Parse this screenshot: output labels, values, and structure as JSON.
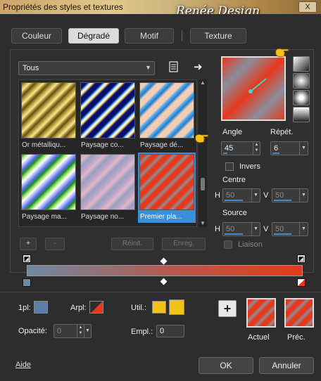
{
  "window": {
    "title": "Propriétés des styles et textures",
    "brand_text": "Renée Design",
    "close_label": "X"
  },
  "tabs": [
    {
      "label": "Couleur",
      "active": false
    },
    {
      "label": "Dégradé",
      "active": true
    },
    {
      "label": "Motif",
      "active": false
    },
    {
      "label": "Texture",
      "active": false
    }
  ],
  "category": {
    "value": "Tous"
  },
  "gradients": [
    {
      "label": "Or métalliqu...",
      "icon": "gold-stripes"
    },
    {
      "label": "Paysage co...",
      "icon": "blue-navy-stripes"
    },
    {
      "label": "Paysage dé...",
      "icon": "blue-peach-stripes"
    },
    {
      "label": "Paysage ma...",
      "icon": "green-blue-stripes"
    },
    {
      "label": "Paysage no...",
      "icon": "mauve-stripes"
    },
    {
      "label": "Premier pla...",
      "icon": "red-grey-stripes",
      "selected": true
    }
  ],
  "list_buttons": {
    "add": "+",
    "remove": "-",
    "reset": "Réinit.",
    "save": "Enreg."
  },
  "angle": {
    "label": "Angle",
    "value": "45"
  },
  "repeat": {
    "label": "Répét.",
    "value": "6"
  },
  "invert": {
    "label": "Invers",
    "checked": false
  },
  "center": {
    "label": "Centre",
    "h_label": "H",
    "h_value": "50",
    "v_label": "V",
    "v_value": "50"
  },
  "source": {
    "label": "Source",
    "h_label": "H",
    "h_value": "50",
    "v_label": "V",
    "v_value": "50"
  },
  "link": {
    "label": "Liaison",
    "checked": false
  },
  "bottom": {
    "pl1_label": "1pl:",
    "arpl_label": "Arpl:",
    "util_label": "Util.:",
    "opacity_label": "Opacité:",
    "opacity_value": "0",
    "empl_label": "Empl.:",
    "empl_value": "0",
    "current_label": "Actuel",
    "previous_label": "Préc."
  },
  "footer": {
    "help": "Aide",
    "ok": "OK",
    "cancel": "Annuler"
  },
  "colors": {
    "accent": "#3b8fd8",
    "gradient_start": "#6d8aa3",
    "gradient_end": "#e43a1a",
    "util_swatch": "#f2c21b"
  }
}
